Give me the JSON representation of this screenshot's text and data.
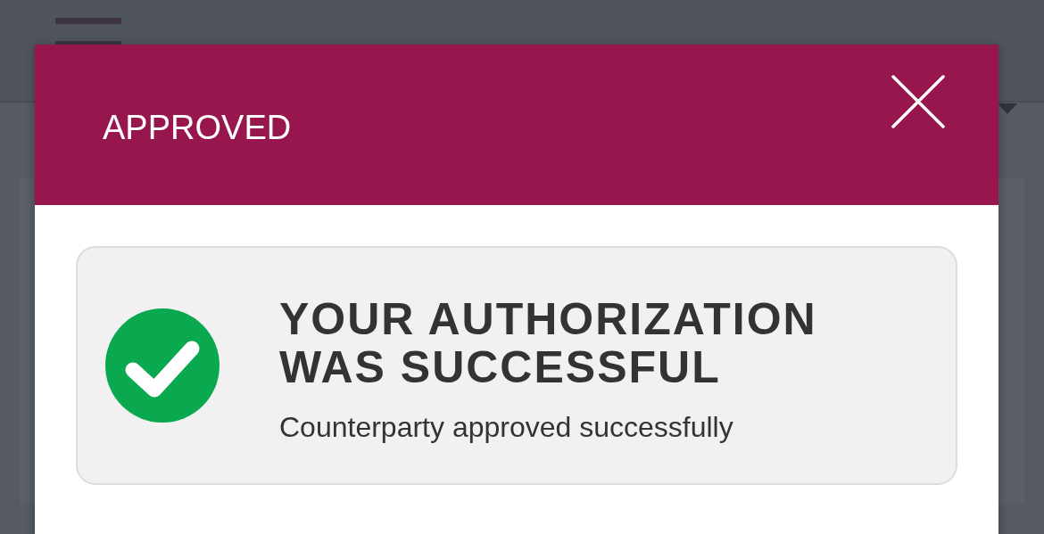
{
  "dialog": {
    "title": "APPROVED",
    "message": {
      "success": true,
      "heading": "YOUR AUTHORIZATION WAS SUCCESSFUL",
      "detail": "Counterparty approved successfully"
    }
  }
}
